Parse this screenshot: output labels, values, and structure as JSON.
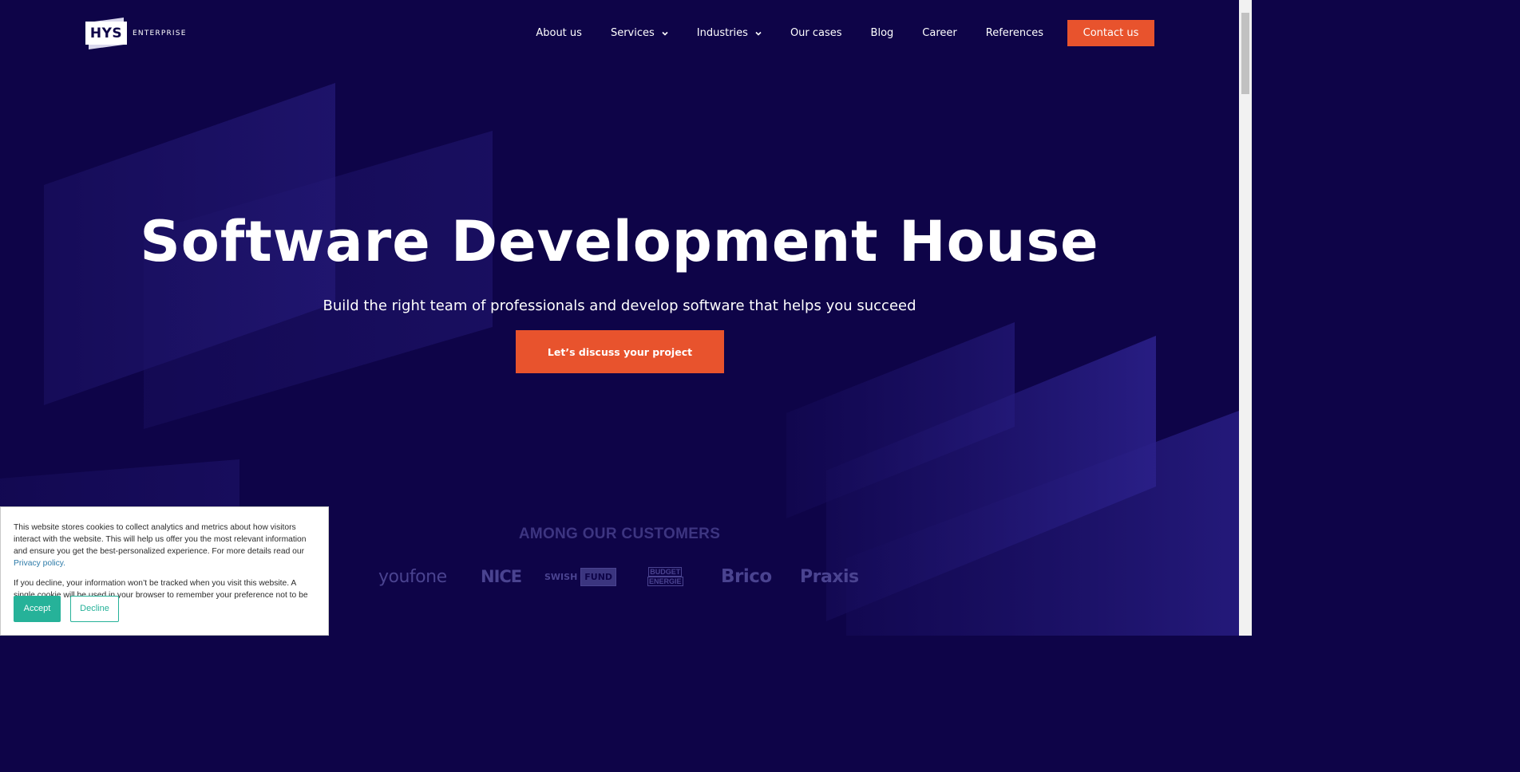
{
  "brand": {
    "logo_mark": "HYS",
    "logo_sub": "ENTERPRISE"
  },
  "nav": {
    "items": [
      {
        "label": "About us",
        "dropdown": false
      },
      {
        "label": "Services",
        "dropdown": true
      },
      {
        "label": "Industries",
        "dropdown": true
      },
      {
        "label": "Our cases",
        "dropdown": false
      },
      {
        "label": "Blog",
        "dropdown": false
      },
      {
        "label": "Career",
        "dropdown": false
      },
      {
        "label": "References",
        "dropdown": false
      }
    ],
    "contact_label": "Contact us"
  },
  "hero": {
    "title": "Software Development House",
    "subtitle": "Build the right team of professionals and develop software that helps you succeed",
    "cta_label": "Let’s discuss your project"
  },
  "customers": {
    "title": "AMONG OUR CUSTOMERS",
    "logos": {
      "youfone": "youfone",
      "nice": "NICE",
      "swish": "SWISH",
      "fund": "FUND",
      "budget_line1": "BUDGET",
      "budget_line2": "ENERGIE",
      "brico": "Brico",
      "praxis": "Praxis"
    }
  },
  "cookie": {
    "text1": "This website stores cookies to collect analytics and metrics about how visitors interact with the website. This will help us offer you the most relevant information and ensure you get the best-personalized experience. For more details read our",
    "privacy_link": "Privacy policy.",
    "text2": "If you decline, your information won’t be tracked when you visit this website. A single cookie will be used in your browser to remember your preference not to be tracked.",
    "accept_label": "Accept",
    "decline_label": "Decline"
  },
  "colors": {
    "background": "#0e0448",
    "accent": "#e8532d",
    "cookie_accent": "#26b299",
    "customer_logo": "#4a4390"
  },
  "icons": {
    "dropdown": "chevron-down-icon"
  }
}
